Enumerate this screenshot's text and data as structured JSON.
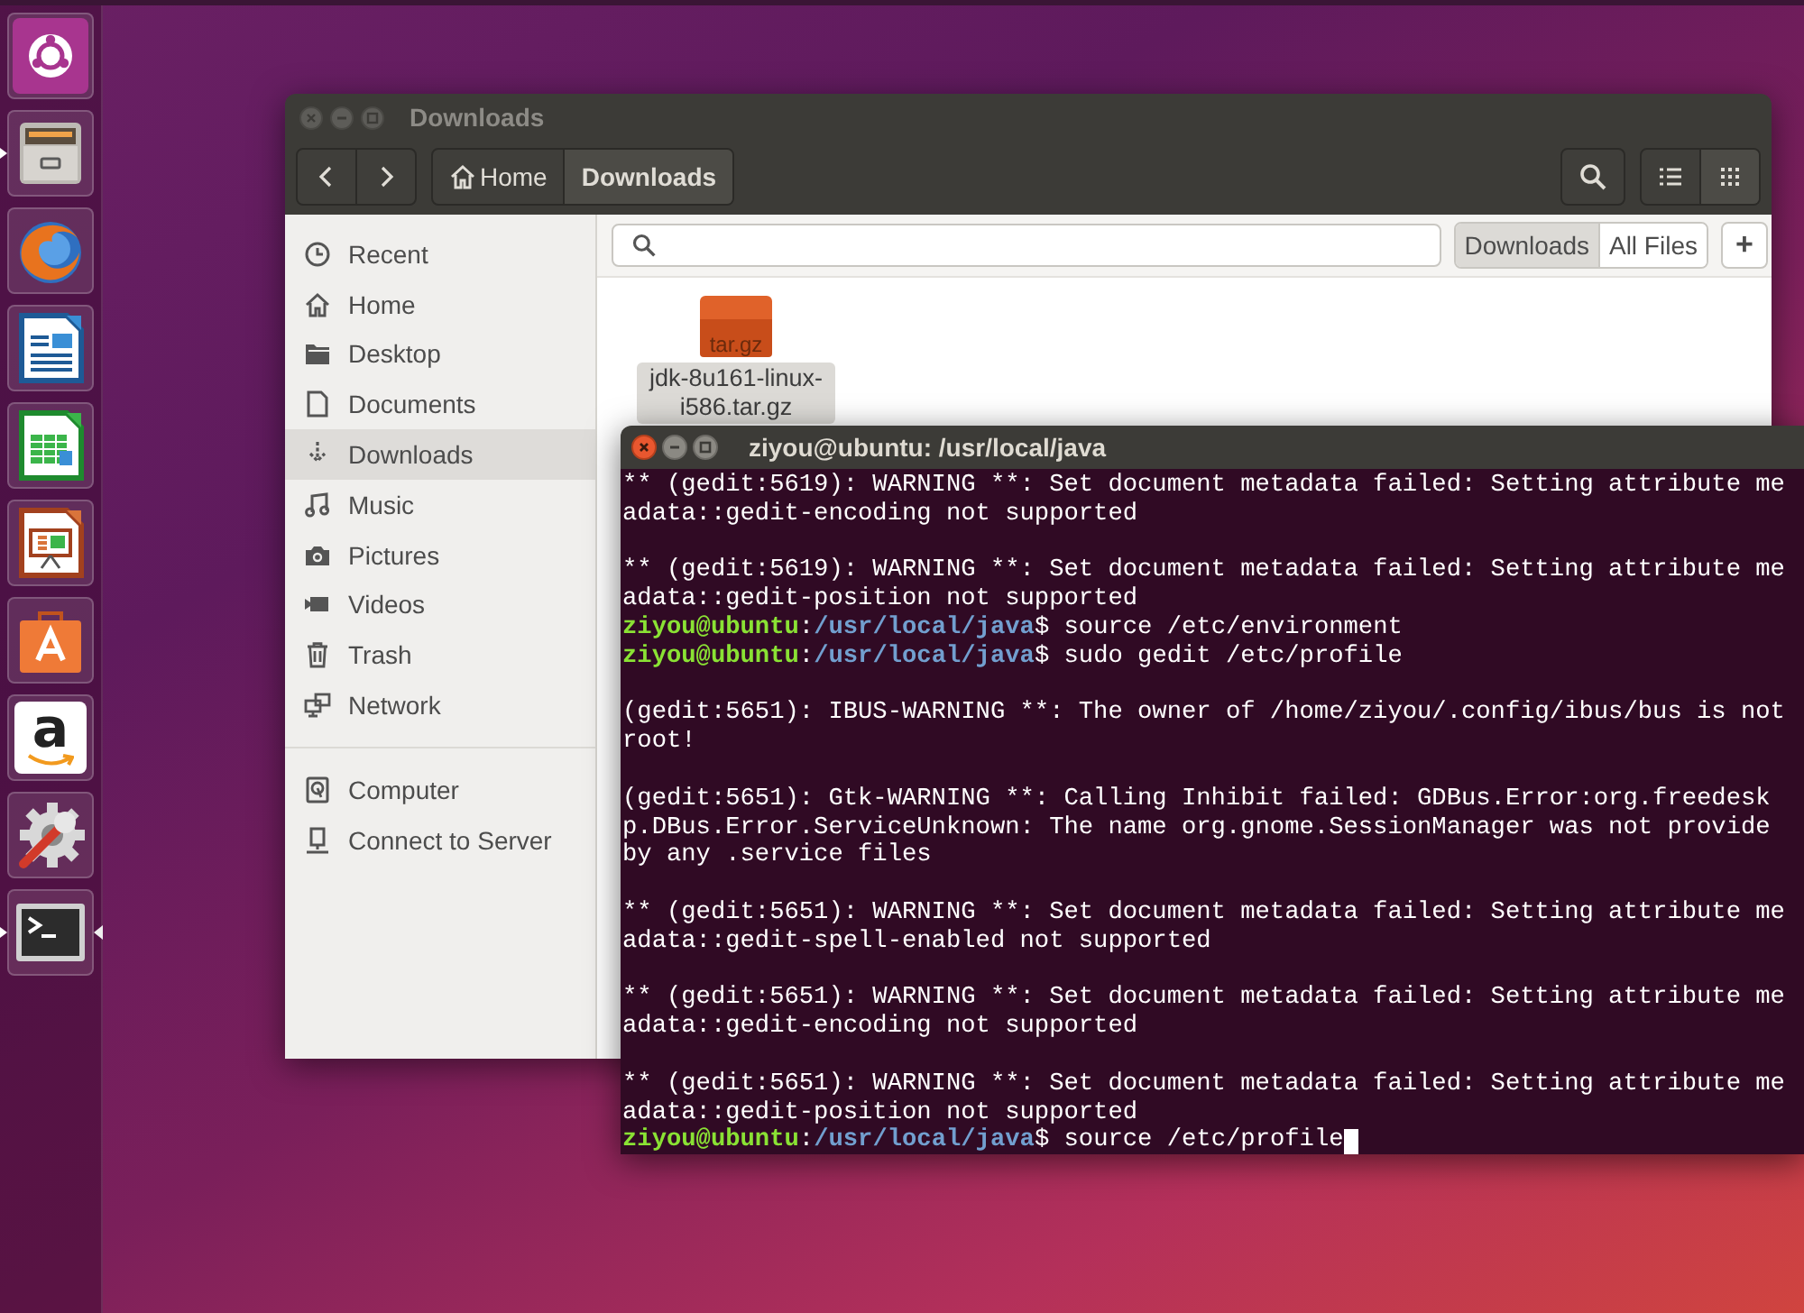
{
  "launcher": [
    {
      "running": false,
      "focused": false
    },
    {
      "running": true,
      "focused": false
    },
    {
      "running": false,
      "focused": false
    },
    {
      "running": false,
      "focused": false
    },
    {
      "running": false,
      "focused": false
    },
    {
      "running": false,
      "focused": false
    },
    {
      "running": false,
      "focused": false
    },
    {
      "running": false,
      "focused": false,
      "glyph": "a"
    },
    {
      "running": false,
      "focused": false
    },
    {
      "running": true,
      "focused": true
    }
  ],
  "files_window": {
    "title": "Downloads",
    "path": [
      {
        "label": "Home",
        "selected": false
      },
      {
        "label": "Downloads",
        "selected": true
      }
    ],
    "view_modes": [
      {
        "selected": false
      },
      {
        "selected": true
      }
    ],
    "sidebar": {
      "places": [
        {
          "label": "Recent",
          "selected": false
        },
        {
          "label": "Home",
          "selected": false
        },
        {
          "label": "Desktop",
          "selected": false
        },
        {
          "label": "Documents",
          "selected": false
        },
        {
          "label": "Downloads",
          "selected": true
        },
        {
          "label": "Music",
          "selected": false
        },
        {
          "label": "Pictures",
          "selected": false
        },
        {
          "label": "Videos",
          "selected": false
        },
        {
          "label": "Trash",
          "selected": false
        },
        {
          "label": "Network",
          "selected": false
        }
      ],
      "devices": [
        {
          "label": "Computer",
          "selected": false
        },
        {
          "label": "Connect to Server",
          "selected": false
        }
      ]
    },
    "scopes": [
      {
        "label": "Downloads",
        "selected": true
      },
      {
        "label": "All Files",
        "selected": false
      }
    ],
    "add_button": "+",
    "files": [
      {
        "name": "jdk-8u161-linux-i586.tar.gz",
        "badge": "tar.gz",
        "selected": true
      }
    ]
  },
  "terminal": {
    "title": "ziyou@ubuntu: /usr/local/java",
    "lines": [
      {
        "kind": "output",
        "text": "** (gedit:5619): WARNING **: Set document metadata failed: Setting attribute me"
      },
      {
        "kind": "output",
        "text": "adata::gedit-encoding not supported"
      },
      {
        "kind": "blank"
      },
      {
        "kind": "output",
        "text": "** (gedit:5619): WARNING **: Set document metadata failed: Setting attribute me"
      },
      {
        "kind": "output",
        "text": "adata::gedit-position not supported"
      },
      {
        "kind": "prompt",
        "user": "ziyou@ubuntu",
        "sep": ":",
        "path": "/usr/local/java",
        "end": "$",
        "command": "source /etc/environment",
        "cursor": false
      },
      {
        "kind": "prompt",
        "user": "ziyou@ubuntu",
        "sep": ":",
        "path": "/usr/local/java",
        "end": "$",
        "command": "sudo gedit /etc/profile",
        "cursor": false
      },
      {
        "kind": "blank"
      },
      {
        "kind": "output",
        "text": "(gedit:5651): IBUS-WARNING **: The owner of /home/ziyou/.config/ibus/bus is not"
      },
      {
        "kind": "output",
        "text": "root!"
      },
      {
        "kind": "blank"
      },
      {
        "kind": "output",
        "text": "(gedit:5651): Gtk-WARNING **: Calling Inhibit failed: GDBus.Error:org.freedesk"
      },
      {
        "kind": "output",
        "text": "p.DBus.Error.ServiceUnknown: The name org.gnome.SessionManager was not provide"
      },
      {
        "kind": "output",
        "text": "by any .service files"
      },
      {
        "kind": "blank"
      },
      {
        "kind": "output",
        "text": "** (gedit:5651): WARNING **: Set document metadata failed: Setting attribute me"
      },
      {
        "kind": "output",
        "text": "adata::gedit-spell-enabled not supported"
      },
      {
        "kind": "blank"
      },
      {
        "kind": "output",
        "text": "** (gedit:5651): WARNING **: Set document metadata failed: Setting attribute me"
      },
      {
        "kind": "output",
        "text": "adata::gedit-encoding not supported"
      },
      {
        "kind": "blank"
      },
      {
        "kind": "output",
        "text": "** (gedit:5651): WARNING **: Set document metadata failed: Setting attribute me"
      },
      {
        "kind": "output",
        "text": "adata::gedit-position not supported"
      },
      {
        "kind": "prompt",
        "user": "ziyou@ubuntu",
        "sep": ":",
        "path": "/usr/local/java",
        "end": "$",
        "command": "source /etc/profile",
        "cursor": true
      }
    ]
  }
}
